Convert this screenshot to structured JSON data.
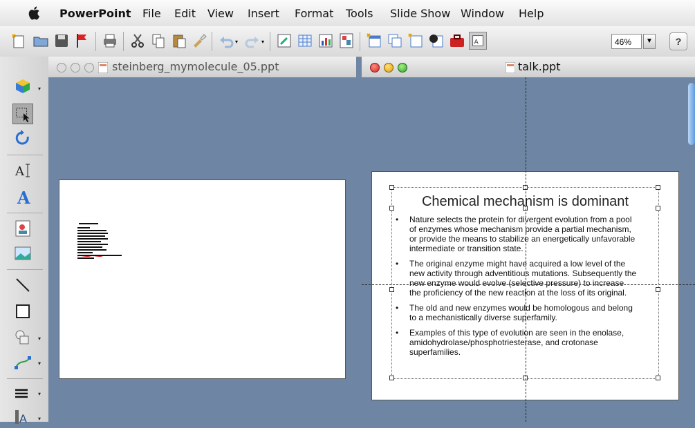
{
  "menubar": {
    "app": "PowerPoint",
    "items": [
      "File",
      "Edit",
      "View",
      "Insert",
      "Format",
      "Tools",
      "Slide Show",
      "Window",
      "Help"
    ]
  },
  "toolbar": {
    "zoom": "46%"
  },
  "windows": [
    {
      "title": "steinberg_mymolecule_05.ppt"
    },
    {
      "title": "talk.ppt"
    }
  ],
  "slide": {
    "title": "Chemical mechanism is dominant",
    "bullets": [
      "Nature selects the protein for divergent evolution from a pool of enzymes whose mechanism provide a partial mechanism, or provide the means to stabilize an energetically unfavorable intermediate or transition state.",
      "The original enzyme might have acquired a low level of the new activity through adventitious mutations. Subsequently the new enzyme would evolve (selective pressure) to increase the proficiency of the new reaction at the loss of its original.",
      "The old and new enzymes would be homologous and belong to a mechanistically diverse superfamily.",
      "Examples of this type of evolution are seen in the enolase, amidohydrolase/phosphotriesterase, and crotonase superfamilies."
    ]
  }
}
